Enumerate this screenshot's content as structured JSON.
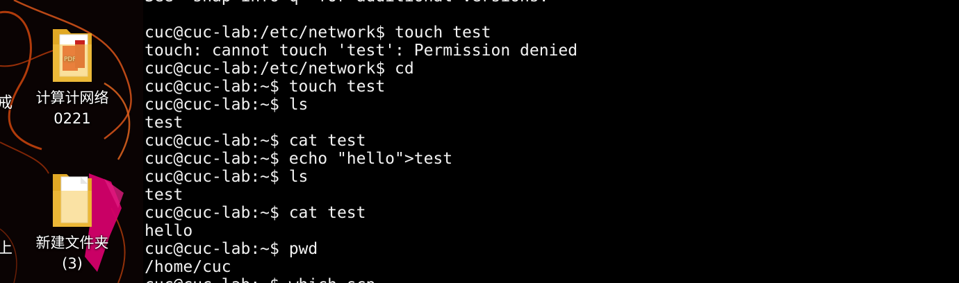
{
  "desktop": {
    "clipped_labels": [
      "戒",
      "上"
    ],
    "icons": [
      {
        "name": "pdf-folder",
        "label": "计算计网络\n0221",
        "icon": "folder-with-pdf-icon"
      },
      {
        "name": "new-folder",
        "label": "新建文件夹\n(3)",
        "icon": "folder-with-document-icon"
      }
    ]
  },
  "terminal": {
    "lines": [
      "See 'snap info q' for additional versions.",
      "",
      "cuc@cuc-lab:/etc/network$ touch test",
      "touch: cannot touch 'test': Permission denied",
      "cuc@cuc-lab:/etc/network$ cd",
      "cuc@cuc-lab:~$ touch test",
      "cuc@cuc-lab:~$ ls",
      "test",
      "cuc@cuc-lab:~$ cat test",
      "cuc@cuc-lab:~$ echo \"hello\">test",
      "cuc@cuc-lab:~$ ls",
      "test",
      "cuc@cuc-lab:~$ cat test",
      "hello",
      "cuc@cuc-lab:~$ pwd",
      "/home/cuc",
      "cuc@cuc-lab:~$ which scp"
    ]
  },
  "colors": {
    "terminal_bg": "#000000",
    "terminal_fg": "#f2f2f2",
    "wallpaper_streak": "#c2410c",
    "wallpaper_magenta": "#d4006a",
    "folder_yellow": "#f6c64a"
  }
}
